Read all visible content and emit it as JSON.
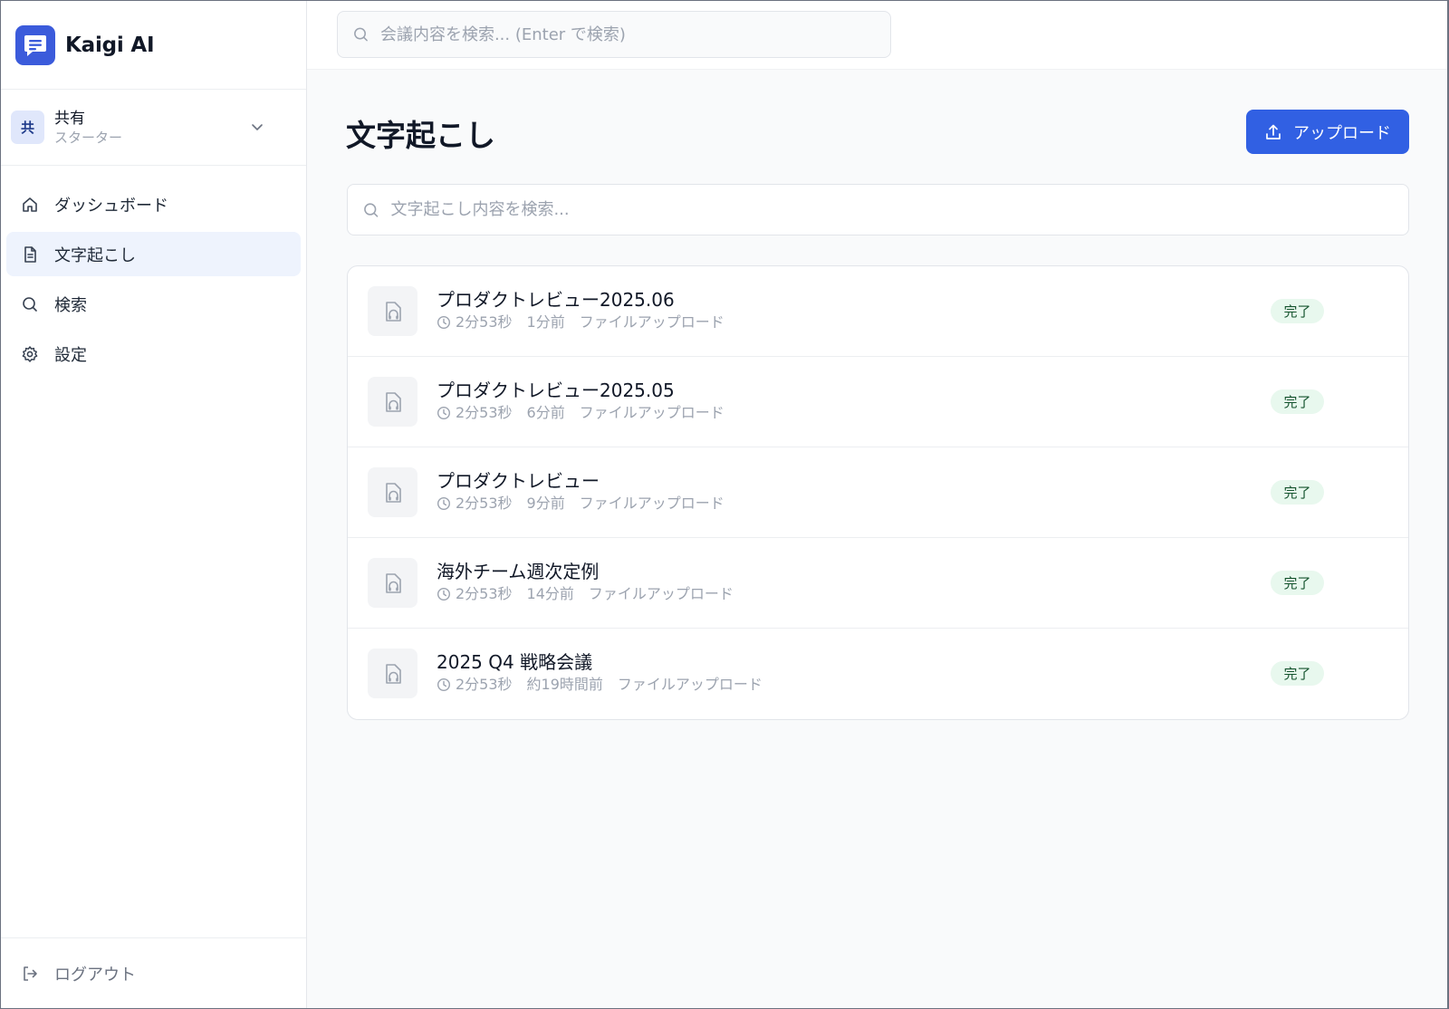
{
  "app": {
    "name": "Kaigi AI"
  },
  "workspace": {
    "avatar_text": "共",
    "name": "共有",
    "plan": "スターター"
  },
  "nav": {
    "items": [
      {
        "label": "ダッシュボード",
        "icon": "home-icon",
        "active": false
      },
      {
        "label": "文字起こし",
        "icon": "document-icon",
        "active": true
      },
      {
        "label": "検索",
        "icon": "search-icon",
        "active": false
      },
      {
        "label": "設定",
        "icon": "gear-icon",
        "active": false
      }
    ],
    "logout_label": "ログアウト"
  },
  "topbar": {
    "search_placeholder": "会議内容を検索... (Enter で検索)"
  },
  "page": {
    "title": "文字起こし",
    "upload_label": "アップロード",
    "search_placeholder": "文字起こし内容を検索..."
  },
  "transcripts": [
    {
      "title": "プロダクトレビュー2025.06",
      "duration": "2分53秒",
      "age": "1分前",
      "source": "ファイルアップロード",
      "status": "完了"
    },
    {
      "title": "プロダクトレビュー2025.05",
      "duration": "2分53秒",
      "age": "6分前",
      "source": "ファイルアップロード",
      "status": "完了"
    },
    {
      "title": "プロダクトレビュー",
      "duration": "2分53秒",
      "age": "9分前",
      "source": "ファイルアップロード",
      "status": "完了"
    },
    {
      "title": "海外チーム週次定例",
      "duration": "2分53秒",
      "age": "14分前",
      "source": "ファイルアップロード",
      "status": "完了"
    },
    {
      "title": "2025 Q4 戦略会議",
      "duration": "2分53秒",
      "age": "約19時間前",
      "source": "ファイルアップロード",
      "status": "完了"
    }
  ],
  "colors": {
    "accent": "#3160e3",
    "nav_active_bg": "#eef3fd",
    "badge_bg": "#e8f8ee",
    "badge_text": "#14532d"
  }
}
